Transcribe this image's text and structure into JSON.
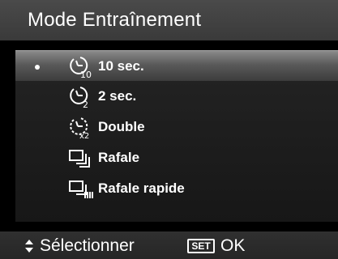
{
  "header": {
    "title": "Mode Entraînement"
  },
  "menu": {
    "selected_index": 0,
    "items": [
      {
        "label": "10 sec.",
        "icon": "self-timer-10s-icon"
      },
      {
        "label": "2 sec.",
        "icon": "self-timer-2s-icon"
      },
      {
        "label": "Double",
        "icon": "self-timer-double-icon"
      },
      {
        "label": "Rafale",
        "icon": "burst-icon"
      },
      {
        "label": "Rafale rapide",
        "icon": "high-speed-burst-icon"
      }
    ]
  },
  "footer": {
    "navigate_icon": "up-down-arrows-icon",
    "navigate_label": "Sélectionner",
    "set_badge": "SET",
    "confirm_label": "OK"
  },
  "colors": {
    "background": "#000000",
    "title_bar": "#3f3f3f",
    "menu_panel": "#1e1e1e",
    "selection_highlight": "#6e6e6e",
    "text": "#ffffff"
  }
}
